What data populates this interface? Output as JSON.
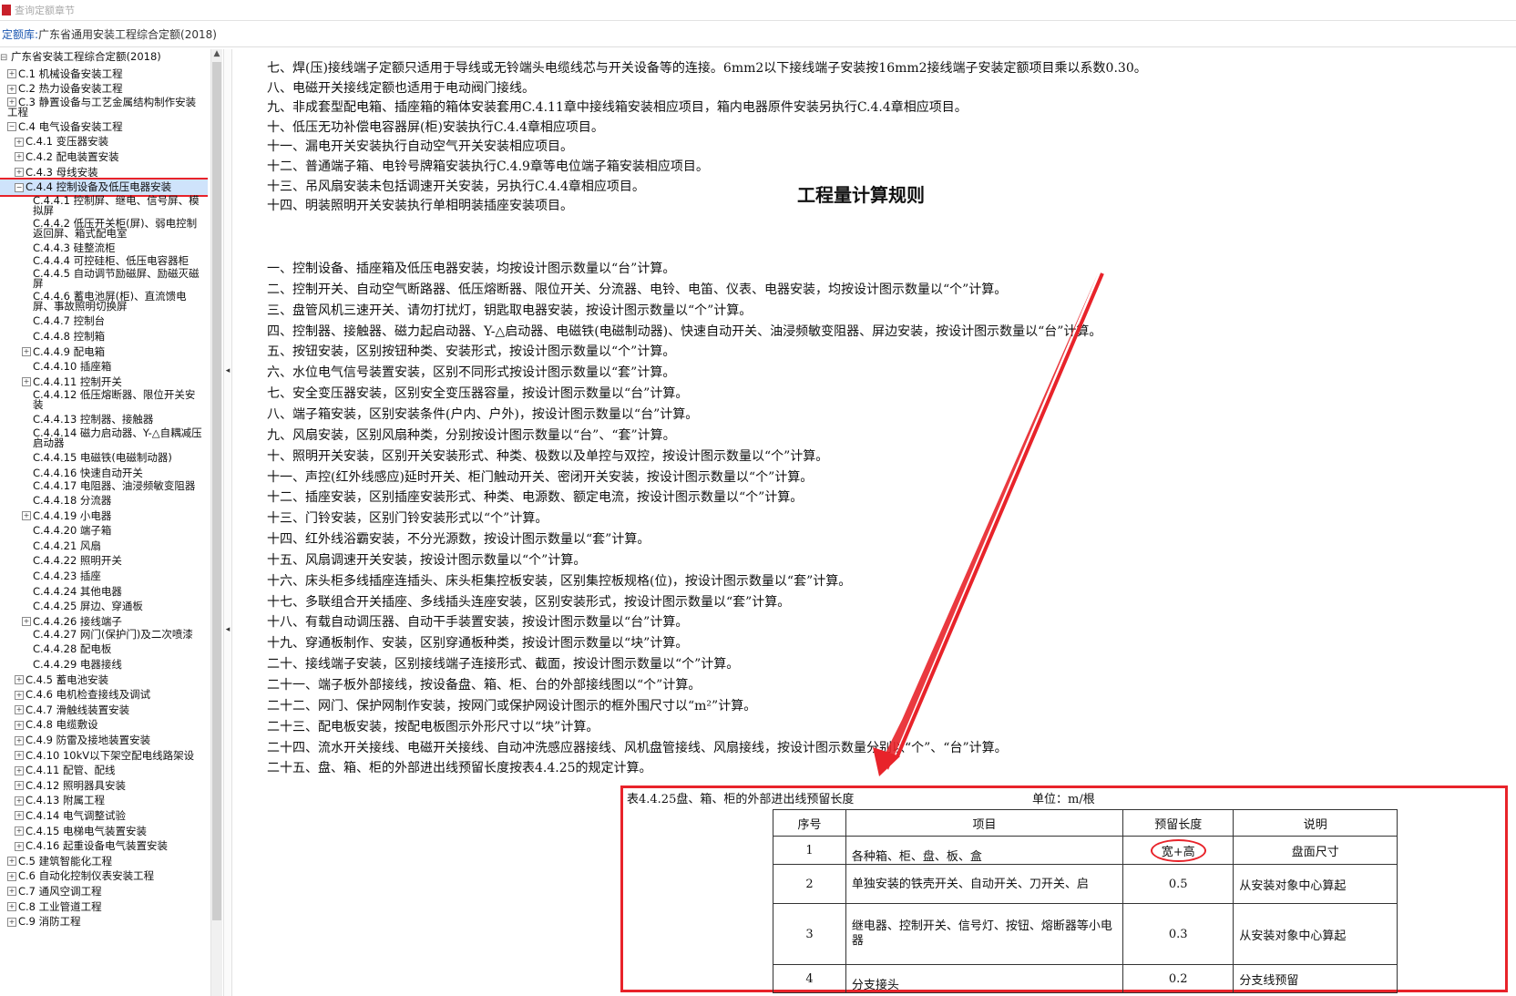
{
  "window": {
    "title": "查询定额章节"
  },
  "library": {
    "label": "定额库:",
    "name": "广东省通用安装工程综合定额(2018)"
  },
  "tree": {
    "root": "广东省安装工程综合定额(2018)",
    "items": [
      "C.1 机械设备安装工程",
      "C.2 热力设备安装工程",
      "C.3 静置设备与工艺金属结构制作安装工程",
      "C.4 电气设备安装工程",
      "C.4.1 变压器安装",
      "C.4.2 配电装置安装",
      "C.4.3 母线安装",
      "C.4.4 控制设备及低压电器安装",
      "C.4.4.1 控制屏、继电、信号屏、模拟屏",
      "C.4.4.2 低压开关柜(屏)、弱电控制返回屏、箱式配电室",
      "C.4.4.3 硅整流柜",
      "C.4.4.4 可控硅柜、低压电容器柜",
      "C.4.4.5 自动调节励磁屏、励磁灭磁屏",
      "C.4.4.6 蓄电池屏(柜)、直流馈电屏、事故照明切换屏",
      "C.4.4.7 控制台",
      "C.4.4.8 控制箱",
      "C.4.4.9 配电箱",
      "C.4.4.10 插座箱",
      "C.4.4.11 控制开关",
      "C.4.4.12 低压熔断器、限位开关安装",
      "C.4.4.13 控制器、接触器",
      "C.4.4.14 磁力启动器、Y-△自耦减压启动器",
      "C.4.4.15 电磁铁(电磁制动器)",
      "C.4.4.16 快速自动开关",
      "C.4.4.17 电阻器、油浸频敏变阻器",
      "C.4.4.18 分流器",
      "C.4.4.19 小电器",
      "C.4.4.20 端子箱",
      "C.4.4.21 风扇",
      "C.4.4.22 照明开关",
      "C.4.4.23 插座",
      "C.4.4.24 其他电器",
      "C.4.4.25 屏边、穿通板",
      "C.4.4.26 接线端子",
      "C.4.4.27 网门(保护门)及二次喷漆",
      "C.4.4.28 配电板",
      "C.4.4.29 电器接线",
      "C.4.5 蓄电池安装",
      "C.4.6 电机检查接线及调试",
      "C.4.7 滑触线装置安装",
      "C.4.8 电缆敷设",
      "C.4.9 防雷及接地装置安装",
      "C.4.10 10kV以下架空配电线路架设",
      "C.4.11 配管、配线",
      "C.4.12 照明器具安装",
      "C.4.13 附属工程",
      "C.4.14 电气调整试验",
      "C.4.15 电梯电气装置安装",
      "C.4.16 起重设备电气装置安装",
      "C.5 建筑智能化工程",
      "C.6 自动化控制仪表安装工程",
      "C.7 通风空调工程",
      "C.8 工业管道工程",
      "C.9 消防工程"
    ]
  },
  "content": {
    "notes": [
      "七、焊(压)接线端子定额只适用于导线或无铃端头电缆线芯与开关设备等的连接。6mm2以下接线端子安装按16mm2接线端子安装定额项目乘以系数0.30。",
      "八、电磁开关接线定额也适用于电动阀门接线。",
      "九、非成套型配电箱、插座箱的箱体安装套用C.4.11章中接线箱安装相应项目，箱内电器原件安装另执行C.4.4章相应项目。",
      "十、低压无功补偿电容器屏(柜)安装执行C.4.4章相应项目。",
      "十一、漏电开关安装执行自动空气开关安装相应项目。",
      "十二、普通端子箱、电铃号牌箱安装执行C.4.9章等电位端子箱安装相应项目。",
      "十三、吊风扇安装未包括调速开关安装，另执行C.4.4章相应项目。",
      "十四、明装照明开关安装执行单相明装插座安装项目。"
    ],
    "rules_heading": "工程量计算规则",
    "rules": [
      "一、控制设备、插座箱及低压电器安装，均按设计图示数量以“台”计算。",
      "二、控制开关、自动空气断路器、低压熔断器、限位开关、分流器、电铃、电笛、仪表、电器安装，均按设计图示数量以“个”计算。",
      "三、盘管风机三速开关、请勿打扰灯，钥匙取电器安装，按设计图示数量以“个”计算。",
      "四、控制器、接触器、磁力起启动器、Y-△启动器、电磁铁(电磁制动器)、快速自动开关、油浸频敏变阻器、屏边安装，按设计图示数量以“台”计算。",
      "五、按钮安装，区别按钮种类、安装形式，按设计图示数量以“个”计算。",
      "六、水位电气信号装置安装，区别不同形式按设计图示数量以“套”计算。",
      "七、安全变压器安装，区别安全变压器容量，按设计图示数量以“台”计算。",
      "八、端子箱安装，区别安装条件(户内、户外)，按设计图示数量以“台”计算。",
      "九、风扇安装，区别风扇种类，分别按设计图示数量以“台”、“套”计算。",
      "十、照明开关安装，区别开关安装形式、种类、极数以及单控与双控，按设计图示数量以“个”计算。",
      "十一、声控(红外线感应)延时开关、柜门触动开关、密闭开关安装，按设计图示数量以“个”计算。",
      "十二、插座安装，区别插座安装形式、种类、电源数、额定电流，按设计图示数量以“个”计算。",
      "十三、门铃安装，区别门铃安装形式以“个”计算。",
      "十四、红外线浴霸安装，不分光源数，按设计图示数量以“套”计算。",
      "十五、风扇调速开关安装，按设计图示数量以“个”计算。",
      "十六、床头柜多线插座连插头、床头柜集控板安装，区别集控板规格(位)，按设计图示数量以“套”计算。",
      "十七、多联组合开关插座、多线插头连座安装，区别安装形式，按设计图示数量以“套”计算。",
      "十八、有载自动调压器、自动干手装置安装，按设计图示数量以“台”计算。",
      "十九、穿通板制作、安装，区别穿通板种类，按设计图示数量以“块”计算。",
      "二十、接线端子安装，区别接线端子连接形式、截面，按设计图示数量以“个”计算。",
      "二十一、端子板外部接线，按设备盘、箱、柜、台的外部接线图以“个”计算。",
      "二十二、网门、保护网制作安装，按网门或保护网设计图示的框外围尺寸以“m²”计算。",
      "二十三、配电板安装，按配电板图示外形尺寸以“块”计算。",
      "二十四、流水开关接线、电磁开关接线、自动冲洗感应器接线、风机盘管接线、风扇接线，按设计图示数量分别以“个”、“台”计算。",
      "二十五、盘、箱、柜的外部进出线预留长度按表4.4.25的规定计算。"
    ]
  },
  "table": {
    "caption": "表4.4.25盘、箱、柜的外部进出线预留长度",
    "unit": "单位：m/根",
    "headers": [
      "序号",
      "项目",
      "预留长度",
      "说明"
    ],
    "rows": [
      [
        "1",
        "各种箱、柜、盘、板、盒",
        "宽+高",
        "盘面尺寸"
      ],
      [
        "2",
        "单独安装的铁壳开关、自动开关、刀开关、启",
        "0.5",
        "从安装对象中心算起"
      ],
      [
        "3",
        "继电器、控制开关、信号灯、按钮、熔断器等小电器",
        "0.3",
        "从安装对象中心算起"
      ],
      [
        "4",
        "分支接头",
        "0.2",
        "分支线预留"
      ]
    ]
  },
  "colors": {
    "annotation": "#e8232a",
    "selection": "#cfe3fb",
    "link": "#1a56b0"
  }
}
